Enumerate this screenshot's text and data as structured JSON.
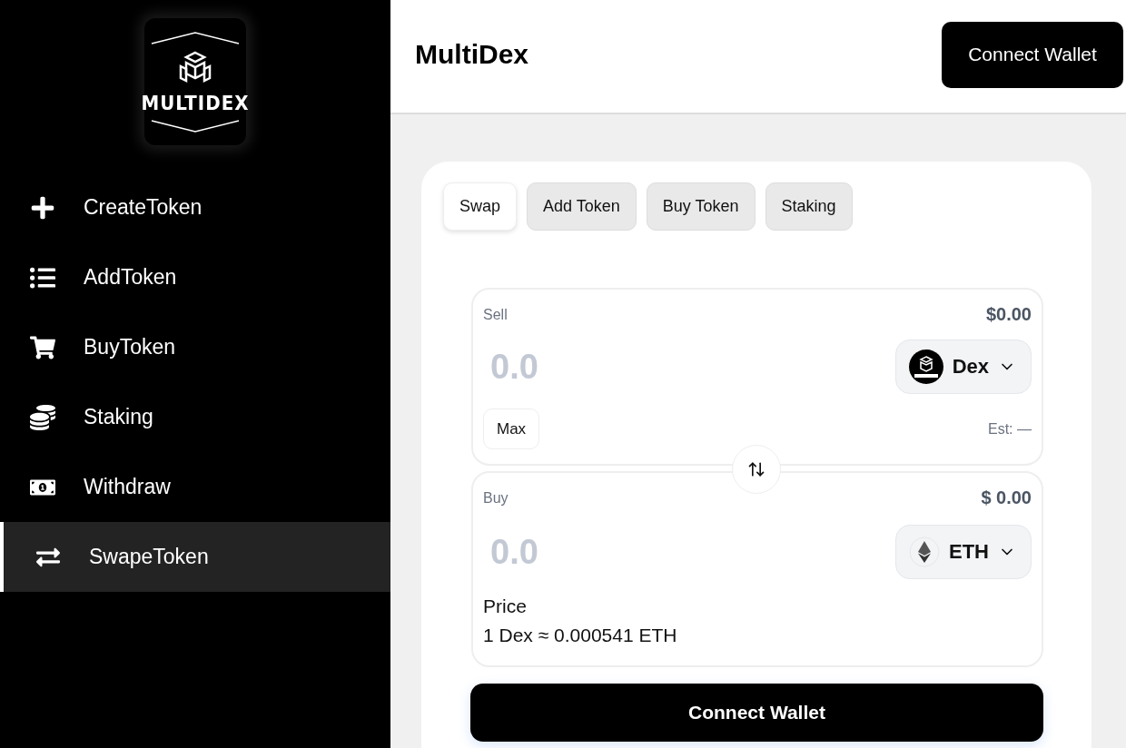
{
  "sidebar": {
    "logo": {
      "text": "MULTIDEX"
    },
    "items": [
      {
        "label": "CreateToken",
        "selected": false
      },
      {
        "label": "AddToken",
        "selected": false
      },
      {
        "label": "BuyToken",
        "selected": false
      },
      {
        "label": "Staking",
        "selected": false
      },
      {
        "label": "Withdraw",
        "selected": false
      },
      {
        "label": "SwapeToken",
        "selected": true
      }
    ]
  },
  "header": {
    "title": "MultiDex",
    "button": "Connect Wallet"
  },
  "tabs": [
    {
      "label": "Swap",
      "selected": true
    },
    {
      "label": "Add Token",
      "selected": false
    },
    {
      "label": "Buy Token",
      "selected": false
    },
    {
      "label": "Staking",
      "selected": false
    }
  ],
  "sell": {
    "label": "Sell",
    "usd": "$0.00",
    "placeholder": "0.0",
    "token": "Dex",
    "max": "Max",
    "estimate": "Est: —"
  },
  "buy": {
    "label": "Buy",
    "usd": "$ 0.00",
    "placeholder": "0.0",
    "token": "ETH",
    "price_label": "Price",
    "price": "1 Dex ≈ 0.000541 ETH"
  },
  "submit": "Connect Wallet"
}
